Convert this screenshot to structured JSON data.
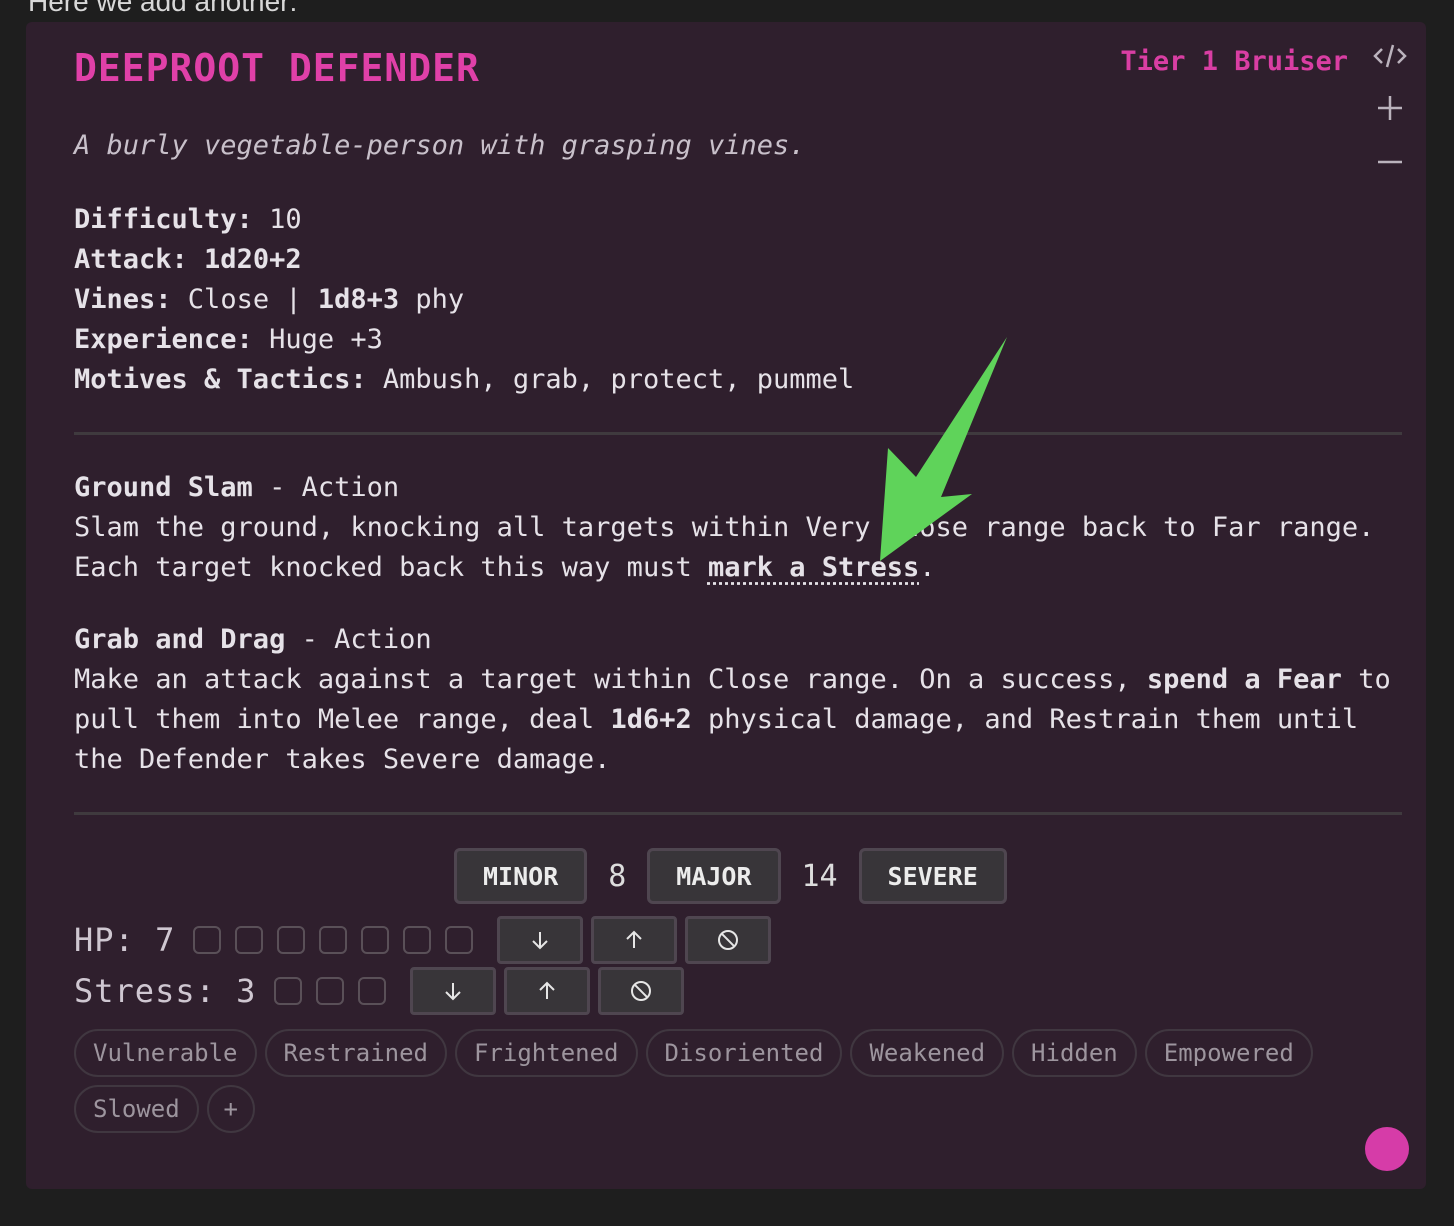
{
  "page": {
    "intro_text": "Here we add another:"
  },
  "card": {
    "title": "DEEPROOT DEFENDER",
    "tier": "Tier 1 Bruiser",
    "description": "A burly vegetable-person with grasping vines.",
    "stats": {
      "difficulty_label": "Difficulty:",
      "difficulty_value": " 10",
      "attack_label": "Attack:",
      "attack_value": " 1d20+2",
      "vines_label": "Vines:",
      "vines_range": " Close | ",
      "vines_damage": "1d8+3",
      "vines_type": " phy",
      "experience_label": "Experience:",
      "experience_value": " Huge +3",
      "motives_label": "Motives & Tactics:",
      "motives_value": " Ambush, grab, protect, pummel"
    },
    "features": [
      {
        "name": "Ground Slam",
        "type": " - Action",
        "text_1": "Slam the ground, knocking all targets within Very Close range back to Far range. Each target knocked back this way must ",
        "highlight": "mark a Stress",
        "text_2": "."
      },
      {
        "name": "Grab and Drag",
        "type": " - Action",
        "text_1": "Make an attack against a target within Close range. On a success, ",
        "highlight_1": "spend a Fear",
        "text_2": " to pull them into Melee range, deal ",
        "highlight_2": "1d6+2",
        "text_3": " physical damage, and Restrain them until the Defender takes Severe damage."
      }
    ],
    "thresholds": {
      "minor_label": "MINOR",
      "minor_major": "8",
      "major_label": "MAJOR",
      "major_severe": "14",
      "severe_label": "SEVERE"
    },
    "hp": {
      "label": "HP: 7",
      "max": 7
    },
    "stress": {
      "label": "Stress: 3",
      "max": 3
    },
    "conditions": [
      "Vulnerable",
      "Restrained",
      "Frightened",
      "Disoriented",
      "Weakened",
      "Hidden",
      "Empowered",
      "Slowed"
    ],
    "add_condition_label": "+"
  },
  "colors": {
    "accent": "#e040a8",
    "card_bg": "#2f1f2d",
    "arrow": "#5fd35a"
  }
}
